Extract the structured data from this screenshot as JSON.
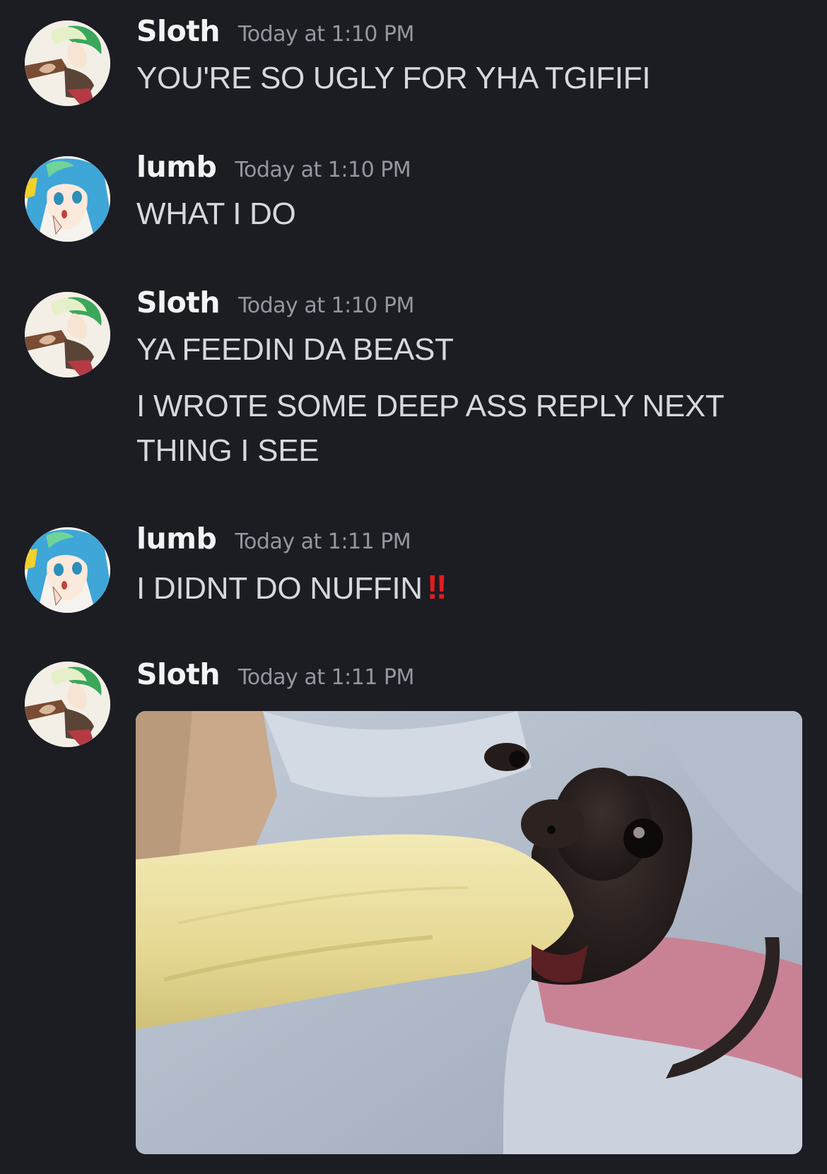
{
  "messages": [
    {
      "author": "Sloth",
      "timestamp": "Today at 1:10 PM",
      "lines": [
        "YOU'RE SO UGLY FOR YHA TGIFIFI"
      ]
    },
    {
      "author": "lumb",
      "timestamp": "Today at 1:10 PM",
      "lines": [
        "WHAT I DO"
      ]
    },
    {
      "author": "Sloth",
      "timestamp": "Today at 1:10 PM",
      "lines": [
        "YA FEEDIN DA BEAST",
        "I WROTE SOME DEEP ASS REPLY NEXT",
        "THING I SEE"
      ]
    },
    {
      "author": "lumb",
      "timestamp": "Today at 1:11 PM",
      "lines": [
        "I DIDNT DO NUFFIN"
      ],
      "emoji": "‼"
    },
    {
      "author": "Sloth",
      "timestamp": "Today at 1:11 PM",
      "attachment": "image-attachment"
    }
  ],
  "colors": {
    "background": "#1c1c23",
    "username": "#f2f3f5",
    "timestamp": "#9597a0",
    "message_text": "#d7d8dc",
    "emoji_red": "#e11c1c"
  }
}
